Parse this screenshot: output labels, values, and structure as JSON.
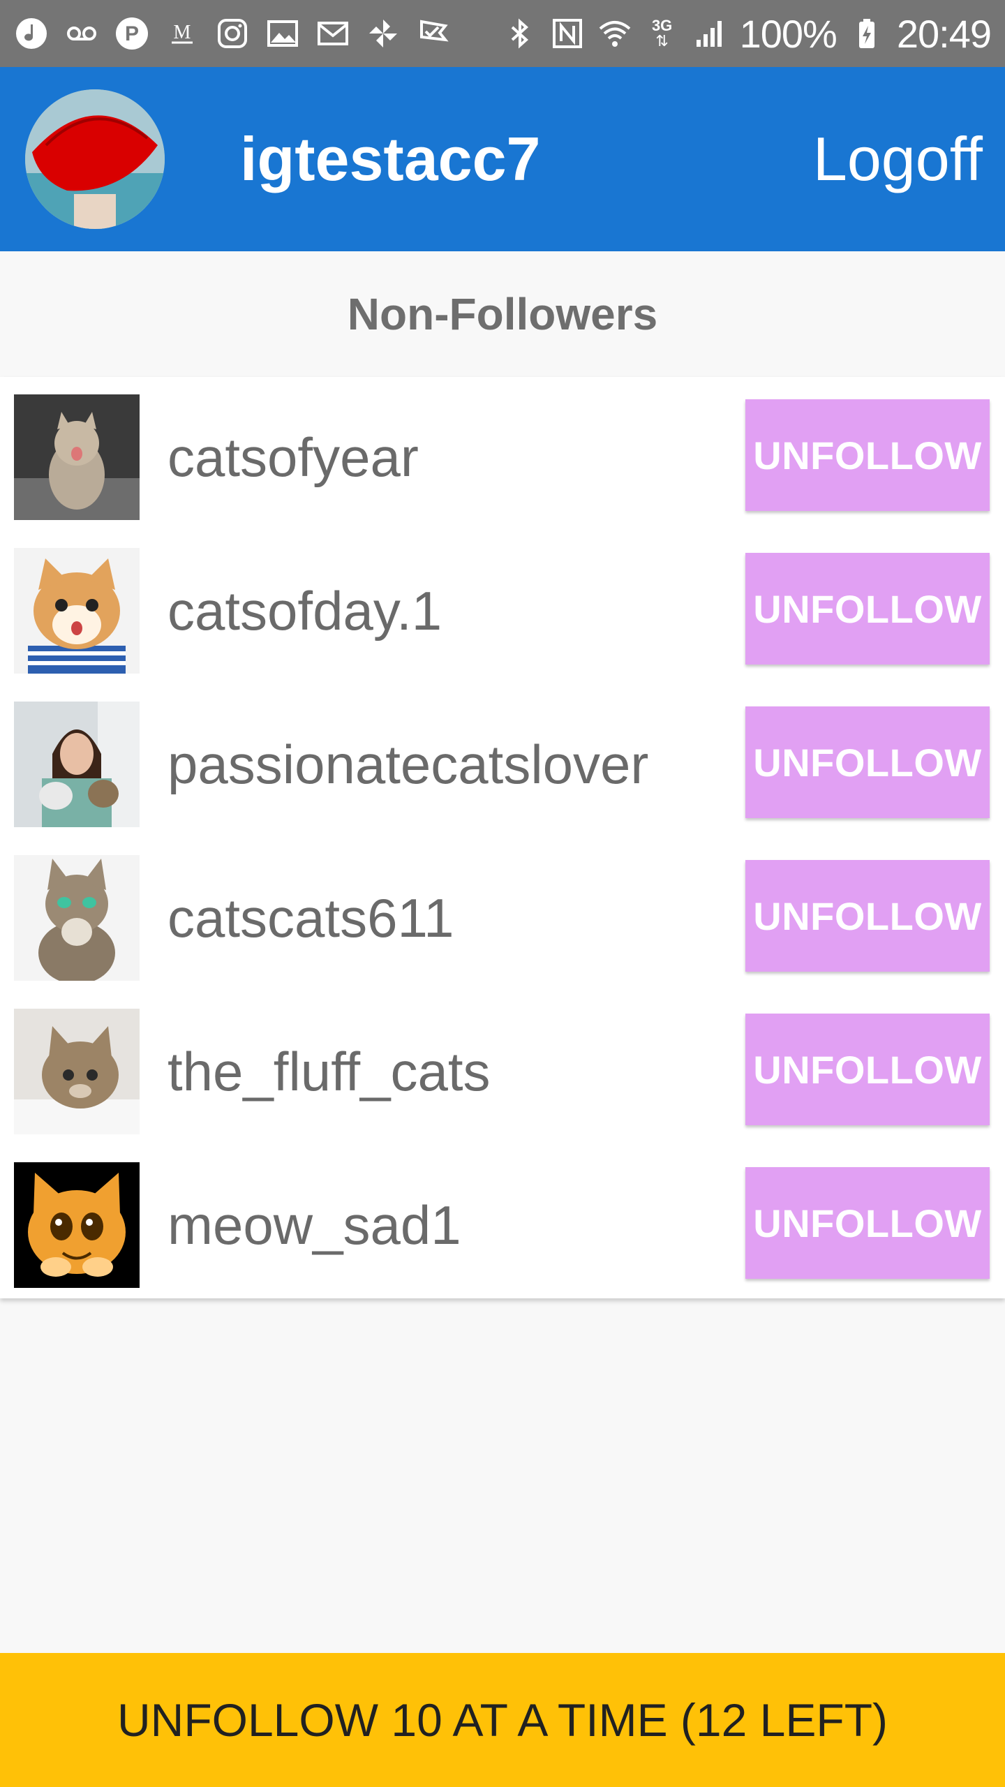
{
  "status_bar": {
    "left_icons": [
      "music-note-icon",
      "voicemail-icon",
      "parking-app-icon",
      "gmail-m-icon",
      "instagram-icon",
      "gallery-icon",
      "email-icon",
      "pinwheel-icon",
      "check-flag-icon"
    ],
    "right_icons": [
      "bluetooth-icon",
      "nfc-icon",
      "wifi-icon",
      "network-3g-icon",
      "signal-icon"
    ],
    "network_type": "3G",
    "battery_percent": "100%",
    "time": "20:49"
  },
  "app_bar": {
    "username": "igtestacc7",
    "logoff_label": "Logoff",
    "background_color": "#1976d2"
  },
  "section": {
    "title": "Non-Followers"
  },
  "non_followers": [
    {
      "name": "catsofyear",
      "button_label": "UNFOLLOW"
    },
    {
      "name": "catsofday.1",
      "button_label": "UNFOLLOW"
    },
    {
      "name": "passionatecatslover",
      "button_label": "UNFOLLOW"
    },
    {
      "name": "catscats611",
      "button_label": "UNFOLLOW"
    },
    {
      "name": "the_fluff_cats",
      "button_label": "UNFOLLOW"
    },
    {
      "name": "meow_sad1",
      "button_label": "UNFOLLOW"
    }
  ],
  "colors": {
    "unfollow_button": "#e1a0f3",
    "bottom_bar": "#ffc107"
  },
  "bottom_bar": {
    "label": "UNFOLLOW 10 AT A TIME (12 LEFT)"
  }
}
